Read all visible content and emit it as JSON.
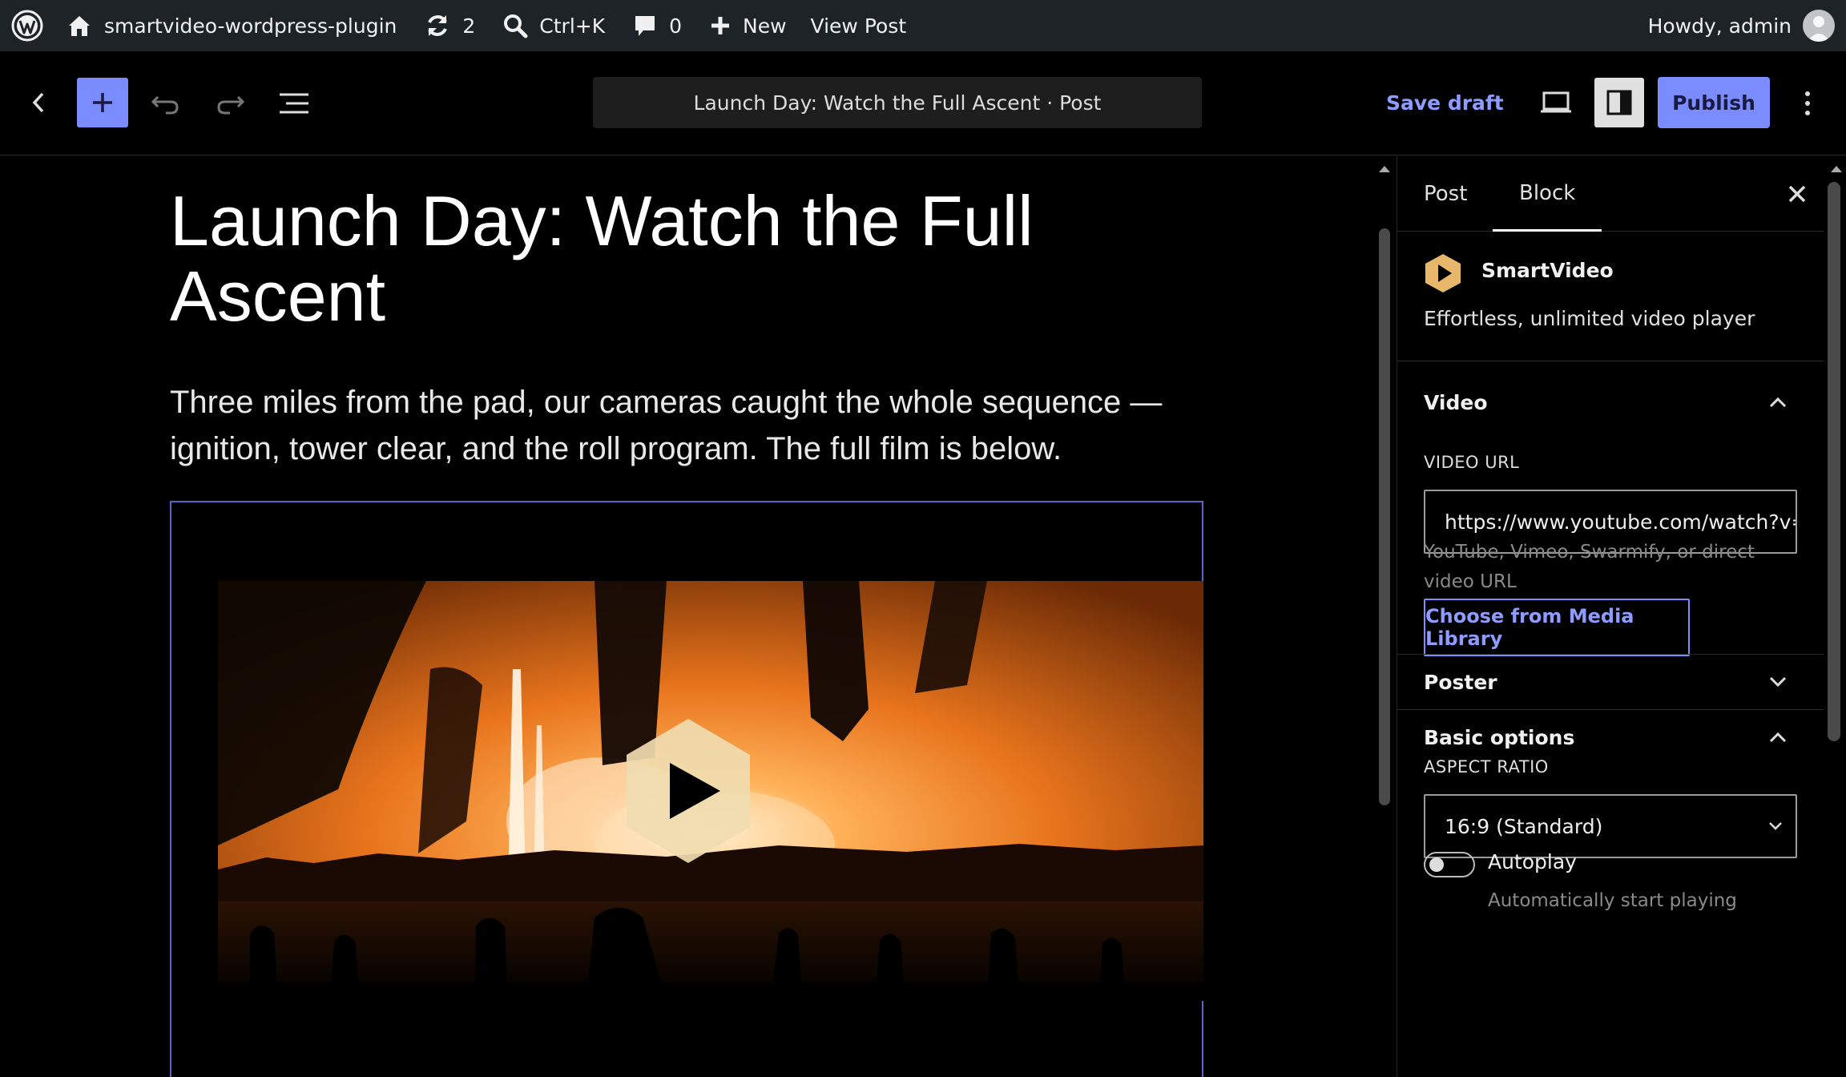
{
  "admin_bar": {
    "site_name": "smartvideo-wordpress-plugin",
    "updates_count": "2",
    "search_shortcut": "Ctrl+K",
    "comments_count": "0",
    "new_label": "New",
    "view_post_label": "View Post",
    "greeting": "Howdy, admin"
  },
  "editor_header": {
    "document_title": "Launch Day: Watch the Full Ascent · Post",
    "save_draft_label": "Save draft",
    "publish_label": "Publish"
  },
  "post": {
    "title": "Launch Day: Watch the Full Ascent",
    "paragraph": "Three miles from the pad, our cameras caught the whole sequence — ignition, tower clear, and the roll program. The full film is below."
  },
  "sidebar": {
    "tabs": [
      {
        "label": "Post",
        "active": false
      },
      {
        "label": "Block",
        "active": true
      }
    ],
    "block_name": "SmartVideo",
    "block_description": "Effortless, unlimited video player",
    "video_panel": {
      "title": "Video",
      "url_label": "VIDEO URL",
      "url_value": "https://www.youtube.com/watch?v=",
      "url_help": "YouTube, Vimeo, Swarmify, or direct video URL",
      "media_button_label": "Choose from Media Library"
    },
    "poster_panel": {
      "title": "Poster"
    },
    "basic_options_panel": {
      "title": "Basic options",
      "aspect_ratio_label": "ASPECT RATIO",
      "aspect_ratio_value": "16:9 (Standard)",
      "autoplay_label": "Autoplay",
      "autoplay_help": "Automatically start playing",
      "autoplay_on": false
    }
  },
  "colors": {
    "accent": "#7b8cff",
    "admin_bar_bg": "#1d2327",
    "selection_border": "#5c63c9",
    "smartvideo_brand": "#e8b86a"
  },
  "icons": {
    "wp_logo": "wordpress-logo-icon",
    "home": "home-icon",
    "updates": "refresh-icon",
    "search": "search-icon",
    "comments": "comment-bubble-icon",
    "new": "plus-icon"
  }
}
